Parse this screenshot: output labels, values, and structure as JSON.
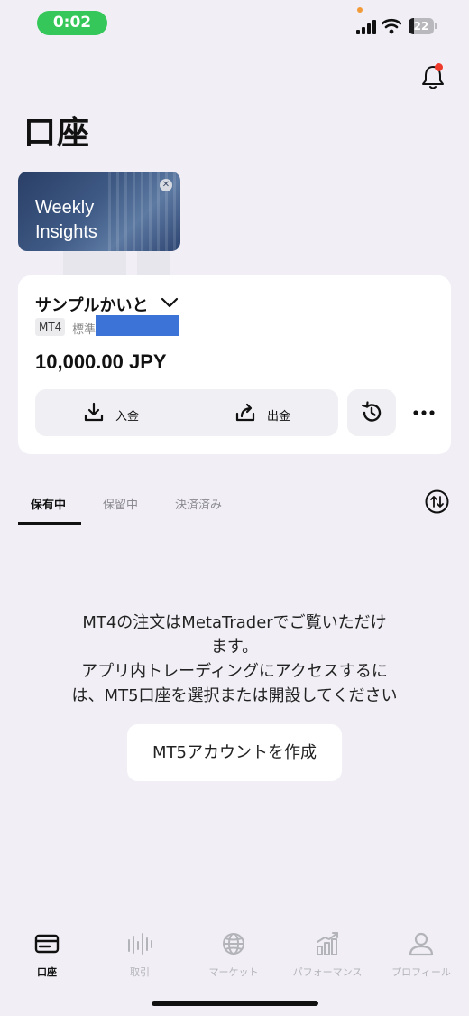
{
  "status_bar": {
    "time": "0:02",
    "battery_level": "22",
    "battery_fraction": 0.22
  },
  "header": {
    "title": "口座"
  },
  "banner": {
    "line1": "Weekly",
    "line2": "Insights"
  },
  "account": {
    "name": "サンプルかいと",
    "platform_badge": "MT4",
    "type": "標準",
    "balance": "10,000.00 JPY",
    "deposit_label": "入金",
    "withdraw_label": "出金"
  },
  "tabs": [
    {
      "label": "保有中",
      "active": true
    },
    {
      "label": "保留中",
      "active": false
    },
    {
      "label": "決済済み",
      "active": false
    }
  ],
  "empty_state": {
    "line1": "MT4の注文はMetaTraderでご覧いただけ",
    "line2": "ます。",
    "line3": "アプリ内トレーディングにアクセスするに",
    "line4": "は、MT5口座を選択または開設してください",
    "button_label": "MT5アカウントを作成"
  },
  "bottom_nav": [
    {
      "label": "口座",
      "icon": "account-card-icon",
      "active": true
    },
    {
      "label": "取引",
      "icon": "trade-candles-icon",
      "active": false
    },
    {
      "label": "マーケット",
      "icon": "globe-icon",
      "active": false
    },
    {
      "label": "パフォーマンス",
      "icon": "performance-chart-icon",
      "active": false
    },
    {
      "label": "プロフィール",
      "icon": "person-icon",
      "active": false
    }
  ],
  "colors": {
    "background": "#f1eff5",
    "time_pill": "#35c759",
    "notification_dot": "#ef3b2c",
    "redaction": "#3b74d6"
  }
}
